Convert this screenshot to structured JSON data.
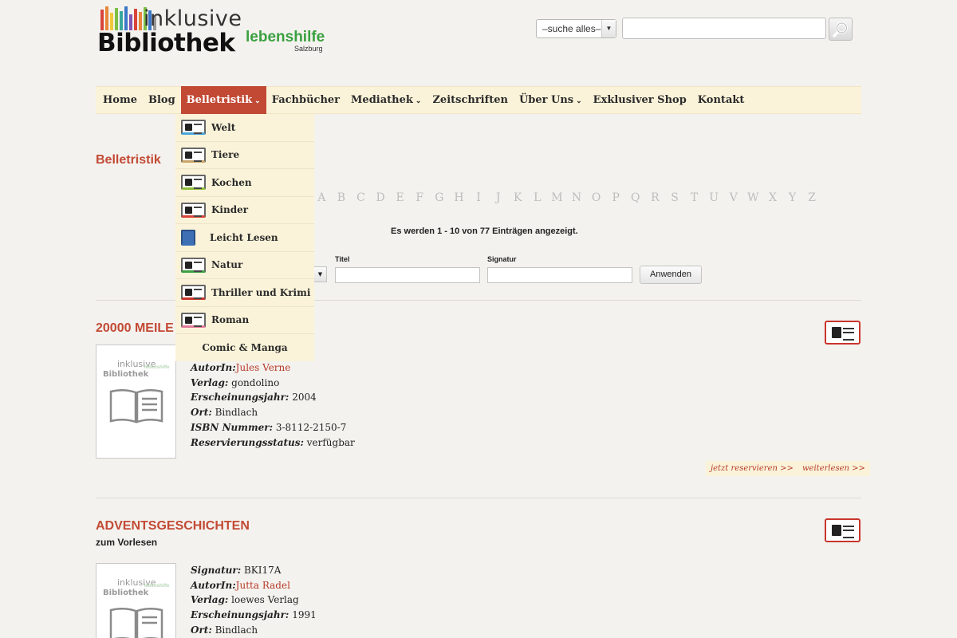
{
  "brand": {
    "line1": "inklusive",
    "line2": "Bibliothek",
    "partner": "lebenshilfe",
    "partner_sub": "Salzburg",
    "bar_colors": [
      "#d9443a",
      "#e8863a",
      "#f2c93d",
      "#7cbf45",
      "#3aa8a0",
      "#3c78c8",
      "#8454b5",
      "#d9443a",
      "#e8863a",
      "#7cbf45",
      "#3c78c8",
      "#999999"
    ]
  },
  "search": {
    "scope": "–suche alles–",
    "placeholder": ""
  },
  "nav": {
    "items": [
      {
        "label": "Home",
        "dropdown": false
      },
      {
        "label": "Blog",
        "dropdown": false
      },
      {
        "label": "Belletristik",
        "dropdown": true,
        "active": true
      },
      {
        "label": "Fachbücher",
        "dropdown": false
      },
      {
        "label": "Mediathek",
        "dropdown": true
      },
      {
        "label": "Zeitschriften",
        "dropdown": false
      },
      {
        "label": "Über Uns",
        "dropdown": true
      },
      {
        "label": "Exklusiver Shop",
        "dropdown": false
      },
      {
        "label": "Kontakt",
        "dropdown": false
      }
    ]
  },
  "dropdown": {
    "items": [
      {
        "label": "Welt",
        "color": "#4da6d9"
      },
      {
        "label": "Tiere",
        "color": "#c9a46a"
      },
      {
        "label": "Kochen",
        "color": "#8fbf3c"
      },
      {
        "label": "Kinder",
        "color": "#d9443a"
      },
      {
        "label": "Leicht Lesen",
        "color": "#3e6fb4",
        "plain": true
      },
      {
        "label": "Natur",
        "color": "#3aa040"
      },
      {
        "label": "Thriller und Krimi",
        "color": "#c8352c"
      },
      {
        "label": "Roman",
        "color": "#e27a9a"
      },
      {
        "label": "Comic & Manga",
        "color": "",
        "noicon": true
      }
    ]
  },
  "section_title": "Belletristik",
  "alphabet": [
    "A",
    "B",
    "C",
    "D",
    "E",
    "F",
    "G",
    "H",
    "I",
    "J",
    "K",
    "L",
    "M",
    "N",
    "O",
    "P",
    "Q",
    "R",
    "S",
    "T",
    "U",
    "V",
    "W",
    "X",
    "Y",
    "Z"
  ],
  "count_text": "Es werden 1 - 10 von 77 Einträgen angezeigt.",
  "filter": {
    "title_label": "Titel",
    "signature_label": "Signatur",
    "apply": "Anwenden"
  },
  "entries": [
    {
      "title": "20000 MEILE",
      "fields": [
        {
          "key": "AutorIn:",
          "value": "Jules Verne",
          "link": true
        },
        {
          "key": "Verlag:",
          "value": " gondolino"
        },
        {
          "key": "Erscheinungsjahr:",
          "value": " 2004"
        },
        {
          "key": "Ort:",
          "value": " Bindlach"
        },
        {
          "key": "ISBN Nummer:",
          "value": " 3-8112-2150-7"
        },
        {
          "key": "Reservierungsstatus:",
          "value": " verfügbar"
        }
      ],
      "actions": [
        "jetzt reservieren >>",
        "weiterlesen >>"
      ]
    },
    {
      "title": "ADVENTSGESCHICHTEN",
      "subtitle": "zum Vorlesen",
      "fields": [
        {
          "key": "Signatur:",
          "value": " BKI17A"
        },
        {
          "key": "AutorIn:",
          "value": "Jutta Radel",
          "link": true
        },
        {
          "key": "Verlag:",
          "value": " loewes Verlag"
        },
        {
          "key": "Erscheinungsjahr:",
          "value": " 1991"
        },
        {
          "key": "Ort:",
          "value": " Bindlach"
        }
      ]
    }
  ]
}
